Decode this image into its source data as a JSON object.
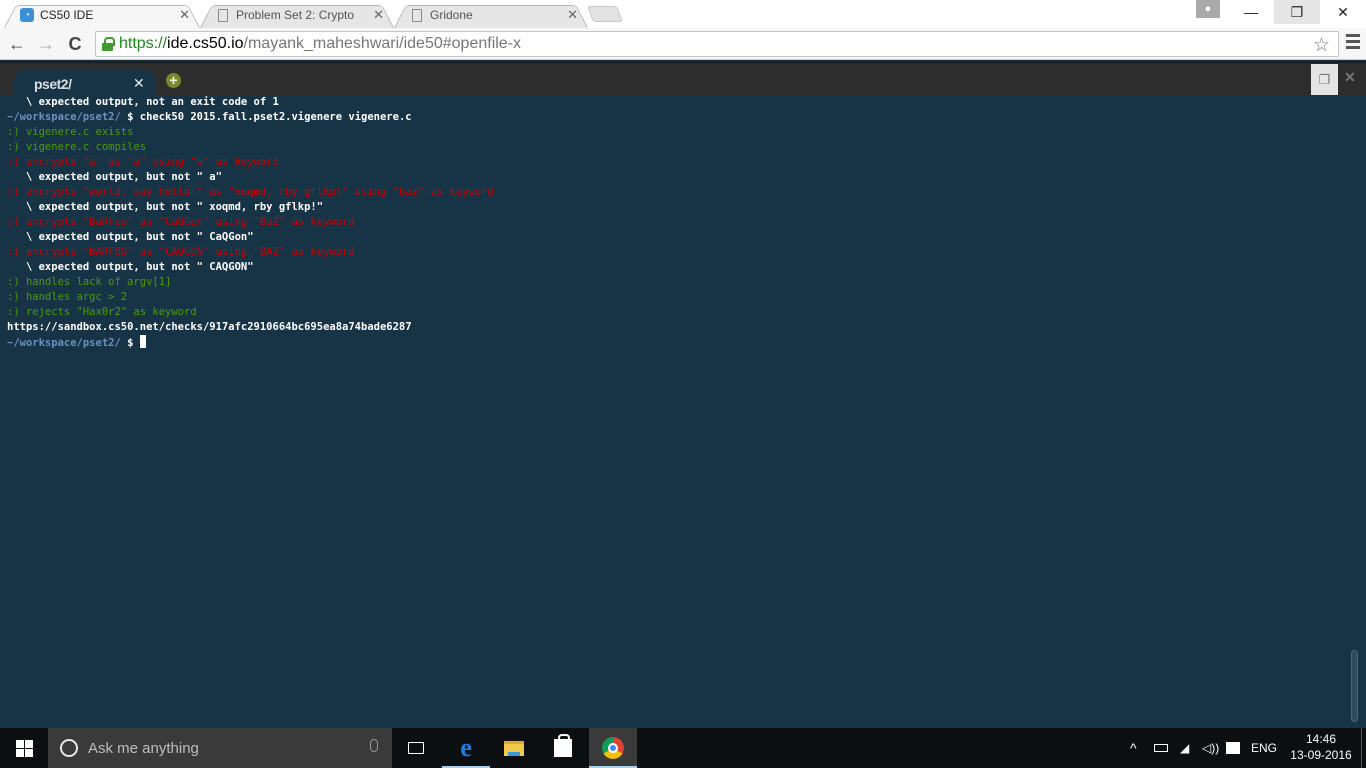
{
  "browser": {
    "tabs": [
      {
        "title": "CS50 IDE",
        "icon": "cs50-favicon",
        "active": true
      },
      {
        "title": "Problem Set 2: Crypto",
        "icon": "page-icon",
        "active": false
      },
      {
        "title": "Gridone",
        "icon": "page-icon",
        "active": false
      }
    ],
    "close_glyph": "✕",
    "url": {
      "scheme": "https://",
      "host": "ide.cs50.io",
      "path": "/mayank_maheshwari/ide50#openfile-x"
    },
    "window_controls": {
      "minimize": "—",
      "restore": "❐",
      "close": "✕"
    },
    "nav": {
      "back": "←",
      "forward": "→",
      "reload": "C"
    },
    "star_glyph": "☆"
  },
  "ide": {
    "tab_title": "pset2/",
    "tab_close": "✕",
    "add_tab": "+",
    "panel_restore": "❐",
    "panel_close": "✕"
  },
  "terminal": {
    "lines": [
      {
        "cls": "white",
        "text": "   \\ expected output, not an exit code of 1"
      },
      {
        "cls": "prompt-cmd",
        "prompt": "~/workspace/pset2/",
        "text": " $ check50 2015.fall.pset2.vigenere vigenere.c"
      },
      {
        "cls": "green",
        "text": ":) vigenere.c exists"
      },
      {
        "cls": "green",
        "text": ":) vigenere.c compiles"
      },
      {
        "cls": "red",
        "text": ":( encrypts \"a\" as \"a\" using \"a\" as keyword"
      },
      {
        "cls": "white",
        "text": "   \\ expected output, but not \" a\""
      },
      {
        "cls": "red",
        "text": ":( encrypts \"world, say hello!\" as \"xoqmd, rby gflkp!\" using \"baz\" as keyword"
      },
      {
        "cls": "white",
        "text": "   \\ expected output, but not \" xoqmd, rby gflkp!\""
      },
      {
        "cls": "red",
        "text": ":( encrypts \"BaRFoo\" as \"CaQGon\" using \"BaZ\" as keyword"
      },
      {
        "cls": "white",
        "text": "   \\ expected output, but not \" CaQGon\""
      },
      {
        "cls": "red",
        "text": ":( encrypts \"BARFOO\" as \"CAQGON\" using \"BAZ\" as keyword"
      },
      {
        "cls": "white",
        "text": "   \\ expected output, but not \" CAQGON\""
      },
      {
        "cls": "green",
        "text": ":) handles lack of argv[1]"
      },
      {
        "cls": "green",
        "text": ":) handles argc > 2"
      },
      {
        "cls": "green",
        "text": ":) rejects \"Hax0r2\" as keyword"
      },
      {
        "cls": "white",
        "text": "https://sandbox.cs50.net/checks/917afc2910664bc695ea8a74bade6287"
      },
      {
        "cls": "prompt-cursor",
        "prompt": "~/workspace/pset2/",
        "text": " $ "
      }
    ]
  },
  "taskbar": {
    "search_placeholder": "Ask me anything",
    "apps": [
      "task-view",
      "edge",
      "file-explorer",
      "store",
      "chrome"
    ],
    "tray": {
      "chevron": "^",
      "language": "ENG",
      "time": "14:46",
      "date": "13-09-2016"
    }
  },
  "colors": {
    "terminal_bg": "#173447",
    "pass": "#4e9a06",
    "fail": "#cc0000",
    "prompt": "#6b8fbf"
  }
}
